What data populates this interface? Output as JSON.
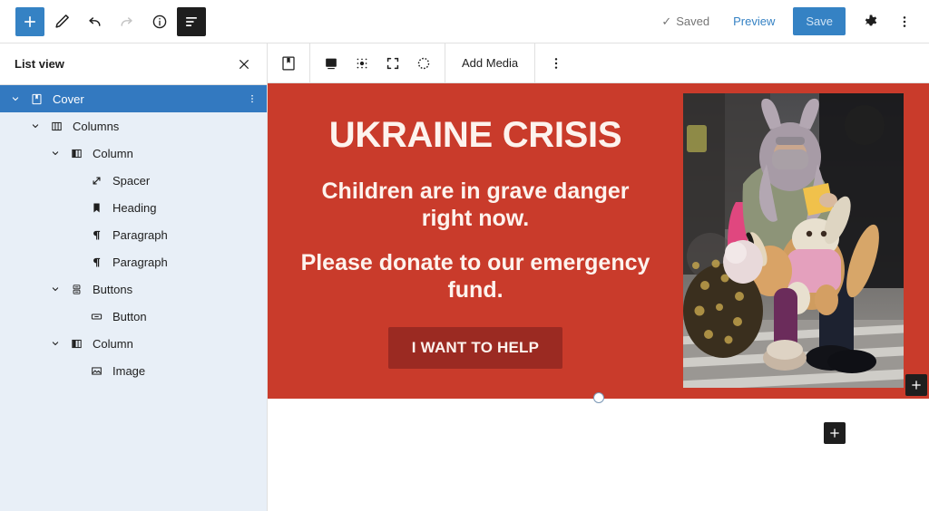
{
  "topbar": {
    "add_block": {
      "label": "Add block",
      "icon": "plus-icon"
    },
    "tools": {
      "label": "Tools",
      "icon": "pencil-icon"
    },
    "undo": {
      "label": "Undo",
      "icon": "undo-icon"
    },
    "redo": {
      "label": "Redo",
      "icon": "redo-icon",
      "state": "disabled"
    },
    "details": {
      "label": "Details",
      "icon": "info-icon"
    },
    "list_view": {
      "label": "List view",
      "icon": "list-view-icon",
      "state": "active"
    },
    "saved_label": "Saved",
    "saved_check": "✓",
    "preview_label": "Preview",
    "save_label": "Save",
    "settings": {
      "label": "Settings",
      "icon": "gear-icon"
    },
    "options": {
      "label": "Options",
      "icon": "kebab-vertical-icon"
    },
    "accent_blue": "#3582c4"
  },
  "listview": {
    "title": "List view",
    "close_label": "Close",
    "selected_row_color": "#3379c0",
    "panel_tint": "#e8eff7",
    "rows": [
      {
        "label": "Cover",
        "depth": 0,
        "icon": "cover-block-icon",
        "chevron": "chevron-down",
        "selected": true,
        "kebab": true
      },
      {
        "label": "Columns",
        "depth": 1,
        "icon": "columns-block-icon",
        "chevron": "chevron-down",
        "selected": false,
        "kebab": false
      },
      {
        "label": "Column",
        "depth": 2,
        "icon": "column-block-icon",
        "chevron": "chevron-down",
        "selected": false,
        "kebab": false
      },
      {
        "label": "Spacer",
        "depth": 3,
        "icon": "spacer-block-icon",
        "chevron": "none",
        "selected": false,
        "kebab": false
      },
      {
        "label": "Heading",
        "depth": 3,
        "icon": "heading-block-icon",
        "chevron": "none",
        "selected": false,
        "kebab": false
      },
      {
        "label": "Paragraph",
        "depth": 3,
        "icon": "paragraph-block-icon",
        "chevron": "none",
        "selected": false,
        "kebab": false
      },
      {
        "label": "Paragraph",
        "depth": 3,
        "icon": "paragraph-block-icon",
        "chevron": "none",
        "selected": false,
        "kebab": false
      },
      {
        "label": "Buttons",
        "depth": 2,
        "icon": "buttons-block-icon",
        "chevron": "chevron-down",
        "selected": false,
        "kebab": false
      },
      {
        "label": "Button",
        "depth": 3,
        "icon": "button-block-icon",
        "chevron": "none",
        "selected": false,
        "kebab": false
      },
      {
        "label": "Column",
        "depth": 2,
        "icon": "column-block-icon",
        "chevron": "chevron-down",
        "selected": false,
        "kebab": false
      },
      {
        "label": "Image",
        "depth": 3,
        "icon": "image-block-icon",
        "chevron": "none",
        "selected": false,
        "kebab": false
      }
    ]
  },
  "block_toolbar": {
    "block_type": {
      "label": "Cover",
      "icon": "cover-block-icon"
    },
    "items": [
      {
        "label": "Change content position",
        "icon": "content-position-icon"
      },
      {
        "label": "Change focal point",
        "icon": "focal-point-icon"
      },
      {
        "label": "Full height toggle",
        "icon": "full-height-icon"
      },
      {
        "label": "Overlay opacity",
        "icon": "dotted-circle-icon"
      }
    ],
    "add_media_label": "Add Media",
    "options": {
      "label": "Options",
      "icon": "kebab-vertical-icon"
    }
  },
  "cover": {
    "background_color": "#c93b2b",
    "heading": "UKRAINE CRISIS",
    "paragraph_1": "Children are in grave danger right now.",
    "paragraph_2": "Please donate to our emergency fund.",
    "button_label": "I WANT TO HELP",
    "button_color": "#9b2a22",
    "text_color": "#fdf3ee",
    "image_alt": "Child carrying stuffed bunny toys walking with luggage across a crosswalk",
    "resize_handle_label": "Drag to resize",
    "inserter_label": "Add block"
  },
  "canvas": {
    "append_inserter_label": "Add block"
  }
}
